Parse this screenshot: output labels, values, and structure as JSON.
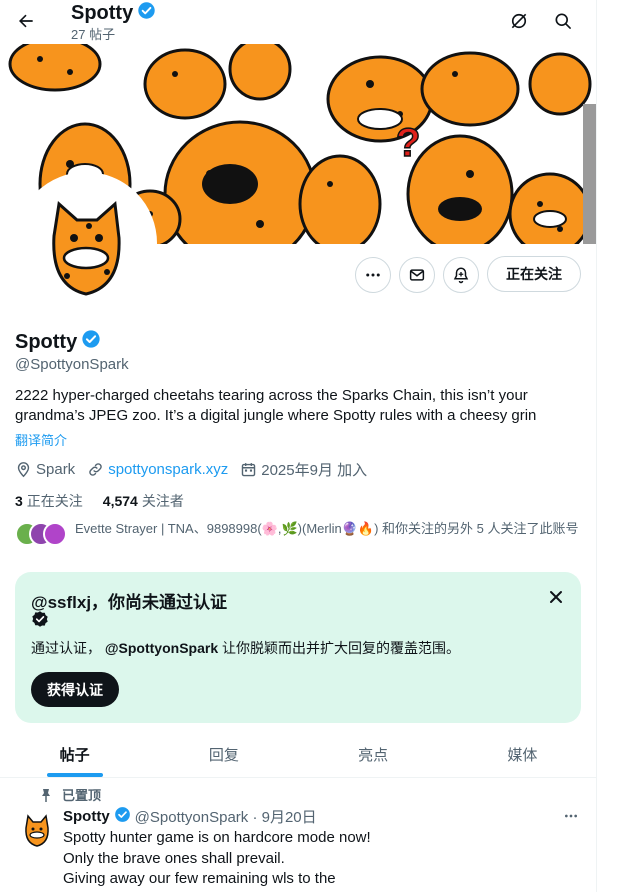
{
  "header": {
    "name": "Spotty",
    "post_count": "27 帖子"
  },
  "profile": {
    "name": "Spotty",
    "handle": "@SpottyonSpark",
    "bio": "2222 hyper-charged cheetahs tearing across the Sparks Chain, this isn’t your grandma’s JPEG zoo. It’s a digital jungle where Spotty rules with a cheesy grin",
    "translate": "翻译简介",
    "location": "Spark",
    "website": "spottyonspark.xyz",
    "joined": "2025年9月 加入",
    "following_count": "3",
    "following_label": "正在关注",
    "followers_count": "4,574",
    "followers_label": "关注者",
    "followed_by_text": "Evette Strayer | TNA、9898998(🌸,🌿)(Merlin🔮🔥) 和你关注的另外 5 人关注了此账号",
    "follow_button": "正在关注"
  },
  "verify_card": {
    "title": "@ssflxj，你尚未通过认证",
    "desc_prefix": "通过认证，",
    "desc_handle": "@SpottyonSpark",
    "desc_suffix": "让你脱颖而出并扩大回复的覆盖范围。",
    "button": "获得认证"
  },
  "tabs": [
    {
      "label": "帖子",
      "active": true
    },
    {
      "label": "回复",
      "active": false
    },
    {
      "label": "亮点",
      "active": false
    },
    {
      "label": "媒体",
      "active": false
    }
  ],
  "pinned_tweet": {
    "pinned_label": "已置顶",
    "name": "Spotty",
    "handle_date": "@SpottyonSpark · 9月20日",
    "text": "Spotty hunter game is on hardcore mode now!\nOnly the brave ones shall prevail.\nGiving away our few remaining wls to the"
  },
  "colors": {
    "accent": "#1d9bf0",
    "verify_card_bg": "#dcf7ec",
    "cheetah_orange": "#f7941d"
  }
}
